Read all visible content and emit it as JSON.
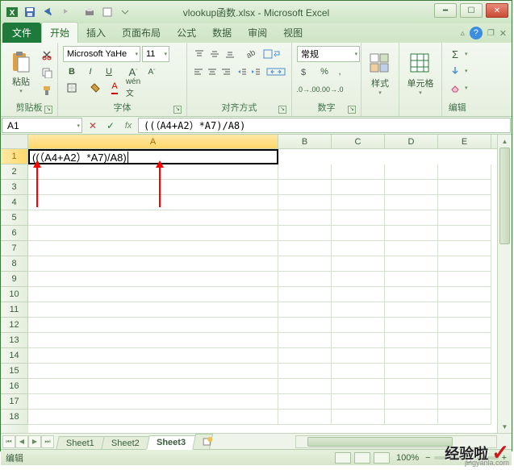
{
  "window": {
    "title": "vlookup函数.xlsx - Microsoft Excel"
  },
  "tabs": {
    "file": "文件",
    "home": "开始",
    "insert": "插入",
    "layout": "页面布局",
    "formulas": "公式",
    "data": "数据",
    "review": "审阅",
    "view": "视图"
  },
  "ribbon": {
    "clipboard": {
      "label": "剪贴板",
      "paste": "粘贴"
    },
    "font": {
      "label": "字体",
      "name": "Microsoft YaHe",
      "size": "11",
      "bold": "B",
      "italic": "I",
      "underline": "U",
      "grow": "A",
      "shrink": "A"
    },
    "align": {
      "label": "对齐方式"
    },
    "number": {
      "label": "数字",
      "format": "常规"
    },
    "styles": {
      "label": "样式"
    },
    "cells": {
      "label": "单元格"
    },
    "editing": {
      "label": "编辑"
    }
  },
  "formula_bar": {
    "name_box": "A1",
    "formula": "((（A4+A2）*A7)/A8)"
  },
  "grid": {
    "columns": [
      "A",
      "B",
      "C",
      "D",
      "E"
    ],
    "rows": [
      "1",
      "2",
      "3",
      "4",
      "5",
      "6",
      "7",
      "8",
      "9",
      "10",
      "11",
      "12",
      "13",
      "14",
      "15",
      "16",
      "17",
      "18"
    ],
    "active_cell_value": "((（A4+A2）*A7)/A8)"
  },
  "sheets": {
    "tabs": [
      "Sheet1",
      "Sheet2",
      "Sheet3"
    ],
    "active": "Sheet3"
  },
  "status": {
    "mode": "编辑",
    "zoom": "100%"
  },
  "watermark": {
    "text": "经验啦",
    "url": "jingyanla.com"
  }
}
